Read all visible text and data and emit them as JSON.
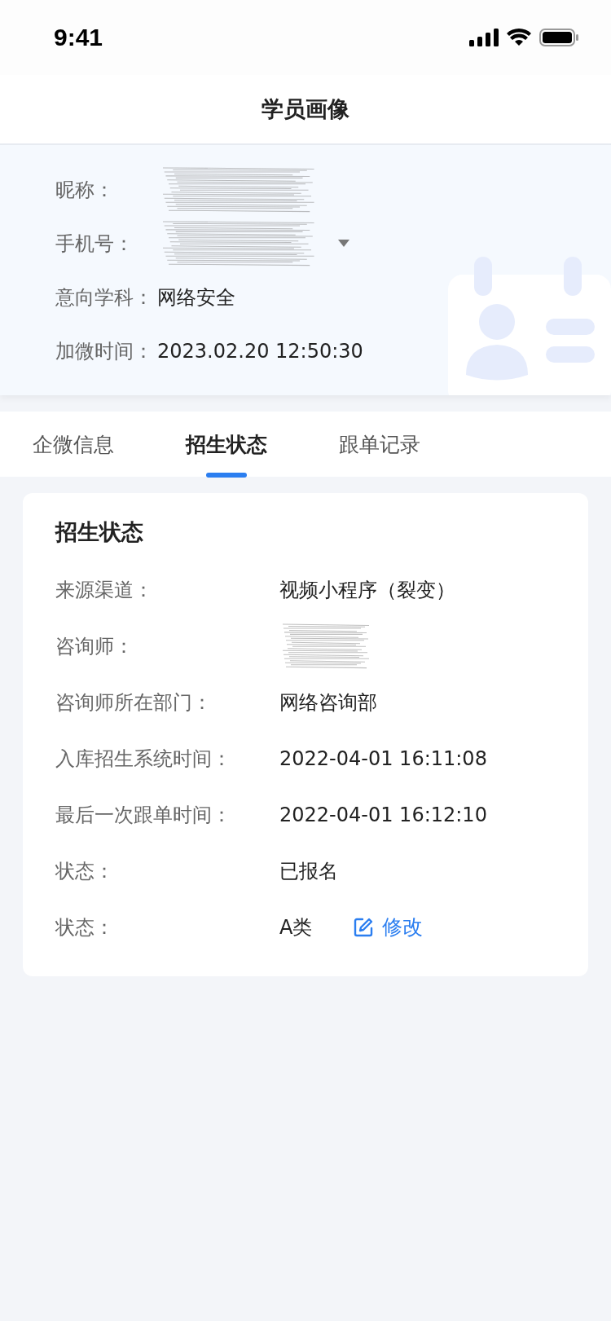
{
  "status_bar": {
    "time": "9:41"
  },
  "nav": {
    "title": "学员画像"
  },
  "profile": {
    "rows": [
      {
        "label": "昵称：",
        "redacted": true
      },
      {
        "label": "手机号：",
        "redacted": true,
        "dropdown": true
      },
      {
        "label": "意向学科：",
        "value": "网络安全"
      },
      {
        "label": "加微时间：",
        "value": "2023.02.20   12:50:30"
      }
    ]
  },
  "tabs": [
    {
      "label": "企微信息",
      "selected": false
    },
    {
      "label": "招生状态",
      "selected": true
    },
    {
      "label": "跟单记录",
      "selected": false
    }
  ],
  "status_card": {
    "title": "招生状态",
    "rows": [
      {
        "label": "来源渠道：",
        "value": "视频小程序（裂变）"
      },
      {
        "label": "咨询师：",
        "redacted": true
      },
      {
        "label": "咨询师所在部门：",
        "value": "网络咨询部"
      },
      {
        "label": "入库招生系统时间：",
        "value": "2022-04-01 16:11:08"
      },
      {
        "label": "最后一次跟单时间：",
        "value": "2022-04-01 16:12:10"
      },
      {
        "label": "状态：",
        "value": "已报名"
      },
      {
        "label": "状态：",
        "value": "A类",
        "action": "修改"
      }
    ]
  }
}
